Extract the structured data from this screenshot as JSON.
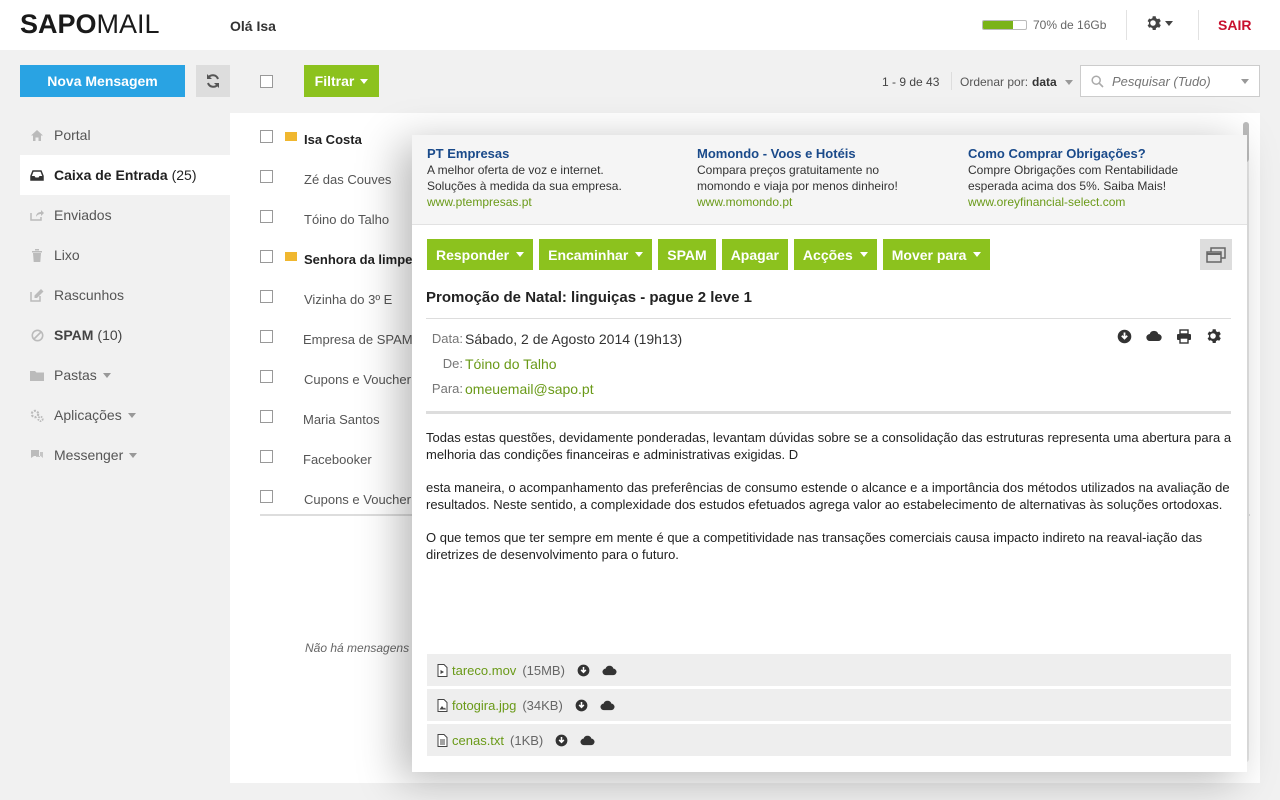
{
  "header": {
    "logo_bold": "SAPO",
    "logo_light": "MAIL",
    "greeting": "Olá Isa",
    "quota_text": "70% de 16Gb",
    "quota_percent": 70,
    "logout": "SAIR"
  },
  "toolbar": {
    "new_message": "Nova Mensagem",
    "filter": "Filtrar",
    "pager": "1 - 9 de 43",
    "sort_label": "Ordenar por:",
    "sort_value": "data",
    "search_placeholder": "Pesquisar (Tudo)"
  },
  "sidebar": {
    "items": [
      {
        "label": "Portal",
        "count": ""
      },
      {
        "label": "Caixa de Entrada",
        "count": "(25)"
      },
      {
        "label": "Enviados",
        "count": ""
      },
      {
        "label": "Lixo",
        "count": ""
      },
      {
        "label": "Rascunhos",
        "count": ""
      },
      {
        "label": "SPAM",
        "count": "(10)"
      },
      {
        "label": "Pastas",
        "count": ""
      },
      {
        "label": "Aplicações",
        "count": ""
      },
      {
        "label": "Messenger",
        "count": ""
      }
    ]
  },
  "messages": [
    {
      "sender": "Isa Costa",
      "unread": true
    },
    {
      "sender": "Zé das Couves",
      "unread": false
    },
    {
      "sender": "Tóino do Talho",
      "unread": false
    },
    {
      "sender": "Senhora da limpe",
      "unread": true
    },
    {
      "sender": "Vizinha do 3º E",
      "unread": false
    },
    {
      "sender": "Empresa de SPAM",
      "unread": false
    },
    {
      "sender": "Cupons e Voucher",
      "unread": false
    },
    {
      "sender": "Maria Santos",
      "unread": false
    },
    {
      "sender": "Facebooker",
      "unread": false
    },
    {
      "sender": "Cupons e Voucher",
      "unread": false
    }
  ],
  "list_empty_text": "Não há mensagens s",
  "ads": [
    {
      "title": "PT Empresas",
      "line1": "A melhor oferta de voz e internet.",
      "line2": "Soluções à medida da sua empresa.",
      "url": "www.ptempresas.pt"
    },
    {
      "title": "Momondo - Voos e Hotéis",
      "line1": "Compara preços gratuitamente no",
      "line2": "momondo e viaja por menos dinheiro!",
      "url": "www.momondo.pt"
    },
    {
      "title": "Como Comprar Obrigações?",
      "line1": "Compre Obrigações com Rentabilidade",
      "line2": "esperada acima dos 5%. Saiba Mais!",
      "url": "www.oreyfinancial-select.com"
    }
  ],
  "actions": {
    "reply": "Responder",
    "forward": "Encaminhar",
    "spam": "SPAM",
    "delete": "Apagar",
    "more": "Acções",
    "move": "Mover para"
  },
  "email": {
    "subject": "Promoção de Natal: linguiças - pague 2 leve 1",
    "date_label": "Data:",
    "date": "Sábado, 2 de Agosto 2014 (19h13)",
    "from_label": "De:",
    "from": "Tóino do Talho",
    "to_label": "Para:",
    "to": "omeuemail@sapo.pt",
    "paragraphs": [
      "Todas estas questões, devidamente ponderadas, levantam dúvidas sobre se a consolidação das estruturas representa uma abertura para a melhoria das condições financeiras e administrativas exigidas. D",
      "esta maneira, o acompanhamento das preferências de consumo estende o alcance e a importância dos métodos utilizados na avaliação de resultados. Neste sentido, a complexidade dos estudos efetuados agrega valor ao estabelecimento de alternativas às soluções ortodoxas.",
      "O que temos que ter sempre em mente é que a competitividade nas transações comerciais causa impacto indireto na reaval-iação das diretrizes de desenvolvimento para o futuro."
    ]
  },
  "attachments": [
    {
      "name": "tareco.mov",
      "size": "(15MB)"
    },
    {
      "name": "fotogira.jpg",
      "size": "(34KB)"
    },
    {
      "name": "cenas.txt",
      "size": "(1KB)"
    }
  ]
}
